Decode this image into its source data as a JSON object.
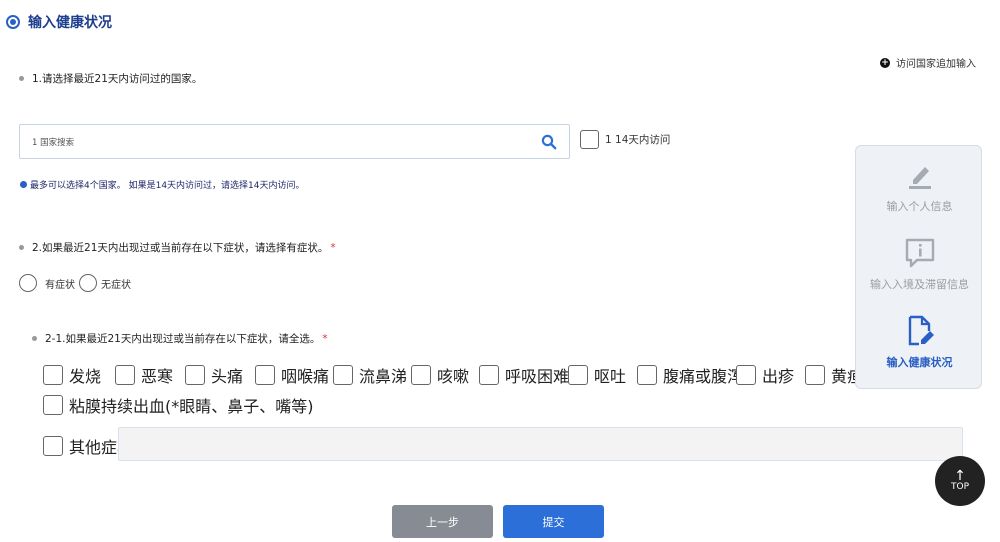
{
  "section_title": "输入健康状况",
  "add_country_link": "访问国家追加输入",
  "q1": {
    "label": "1.请选择最近21天内访问过的国家。",
    "search_placeholder": "1 国家搜索",
    "within14_label": "1 14天内访问",
    "note": "最多可以选择4个国家。 如果是14天内访问过，请选择14天内访问。"
  },
  "q2": {
    "label": "2.如果最近21天内出现过或当前存在以下症状，请选择有症状。",
    "required_mark": "*",
    "option_yes": "有症状",
    "option_no": "无症状"
  },
  "q21": {
    "label": "2-1.如果最近21天内出现过或当前存在以下症状，请全选。",
    "required_mark": "*",
    "symptoms": [
      "发烧",
      "恶寒",
      "头痛",
      "咽喉痛",
      "流鼻涕",
      "咳嗽",
      "呼吸困难",
      "呕吐",
      "腹痛或腹泻",
      "出疹",
      "黄疸"
    ],
    "bleeding": "粘膜持续出血(*眼睛、鼻子、嘴等)",
    "other_label": "其他症状",
    "other_value": ""
  },
  "side_menu": {
    "items": [
      "输入个人信息",
      "输入入境及滞留信息",
      "输入健康状况"
    ],
    "active_index": 2
  },
  "top_button": "TOP",
  "buttons": {
    "prev": "上一步",
    "submit": "提交"
  },
  "colors": {
    "accent": "#2d6fd8",
    "title": "#1e3f8f",
    "required": "#e0323a",
    "prev_button": "#878b93"
  }
}
